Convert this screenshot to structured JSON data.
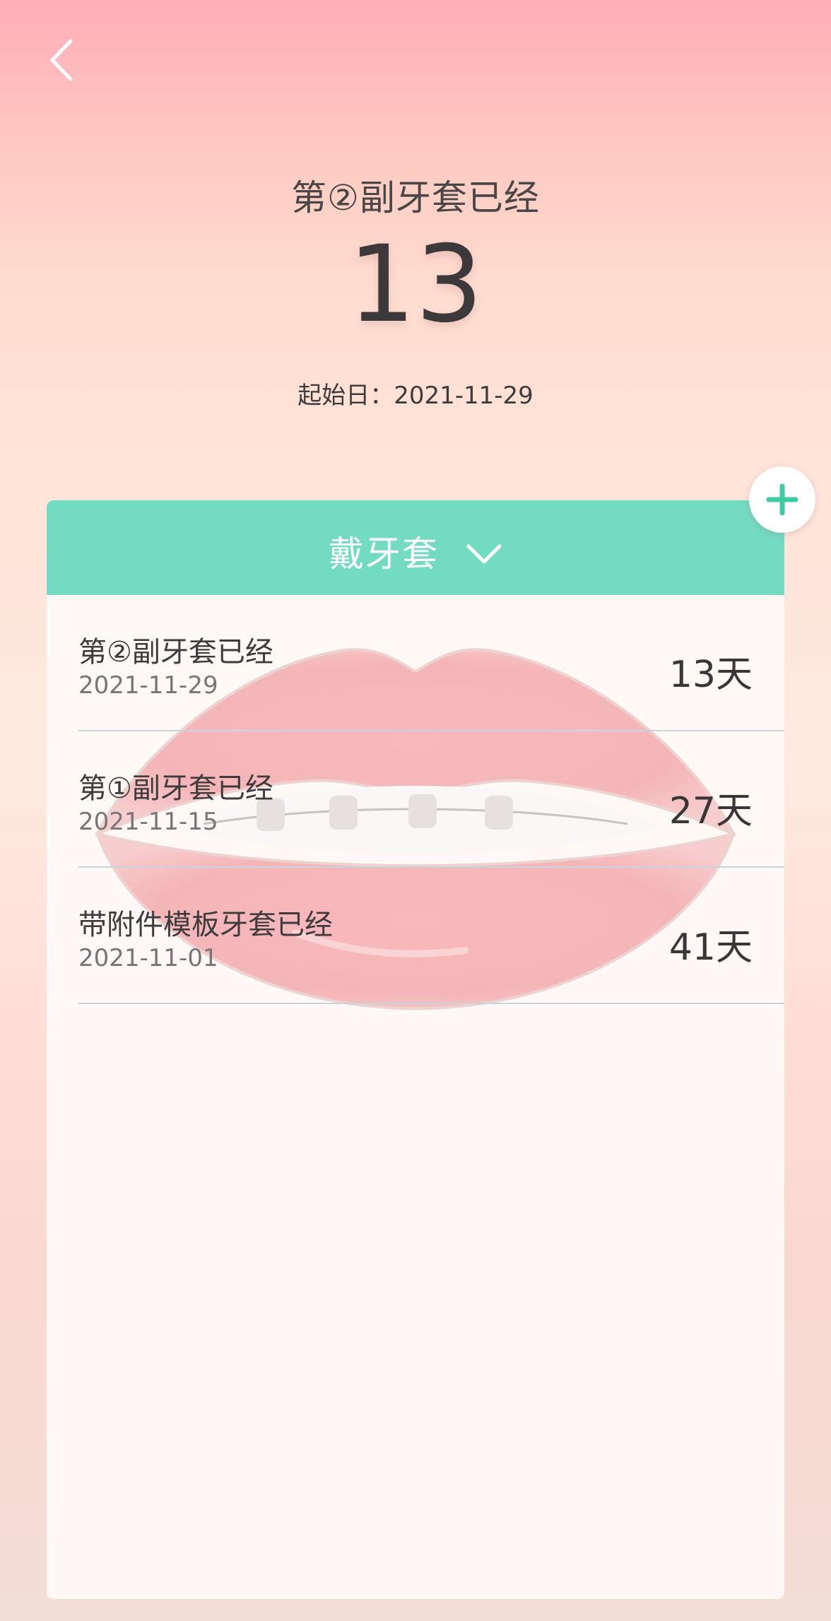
{
  "hero": {
    "title": "第②副牙套已经",
    "count": "13",
    "start_label": "起始日：",
    "start_date": "2021-11-29"
  },
  "card": {
    "header_label": "戴牙套",
    "header_color": "#74dbc3",
    "records": [
      {
        "title": "第②副牙套已经",
        "date": "2021-11-29",
        "days": "13天"
      },
      {
        "title": "第①副牙套已经",
        "date": "2021-11-15",
        "days": "27天"
      },
      {
        "title": "带附件模板牙套已经",
        "date": "2021-11-01",
        "days": "41天"
      }
    ]
  },
  "icons": {
    "back": "chevron-left-icon",
    "dropdown": "chevron-down-icon",
    "add": "plus-icon",
    "background_art": "lips-with-braces-illustration"
  },
  "colors": {
    "accent": "#74dbc3",
    "background_top": "#ffadb8",
    "text_primary": "#3f3b3c"
  }
}
